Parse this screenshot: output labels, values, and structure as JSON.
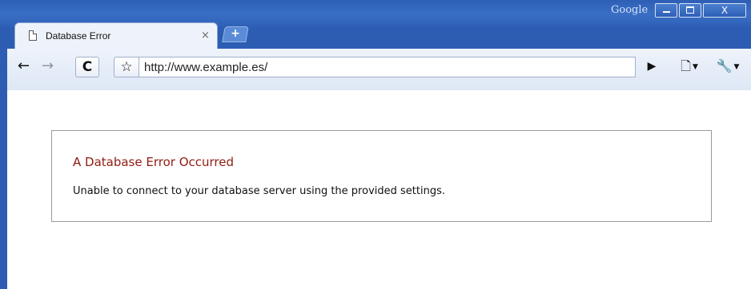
{
  "titlebar": {
    "brand": "Google"
  },
  "tab": {
    "title": "Database Error",
    "close_icon": "close-icon"
  },
  "new_tab": {
    "icon": "plus-icon"
  },
  "toolbar": {
    "back_icon": "arrow-left-icon",
    "forward_icon": "arrow-right-icon",
    "reload_icon": "reload-icon",
    "bookmark_icon": "star-icon",
    "url": "http://www.example.es/",
    "go_icon": "play-icon",
    "page_menu_icon": "page-icon",
    "tools_menu_icon": "wrench-icon"
  },
  "page": {
    "error_title": "A Database Error Occurred",
    "error_message": "Unable to connect to your database server using the provided settings."
  },
  "colors": {
    "frame": "#2c5db3",
    "error_title": "#8f1b12",
    "border": "#999999"
  }
}
